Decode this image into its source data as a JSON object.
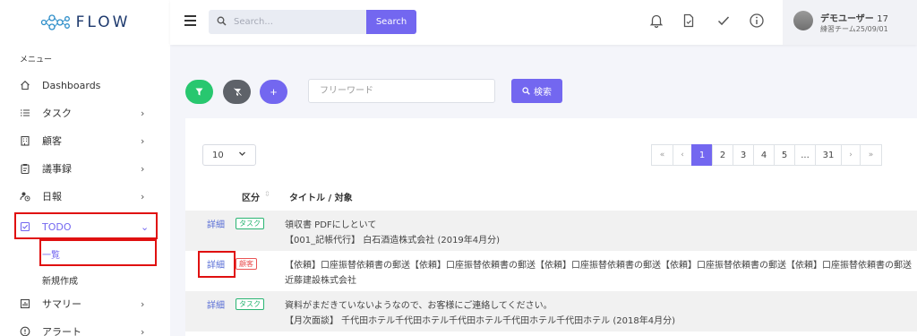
{
  "brand": {
    "logo_text": "FLOW"
  },
  "sidebar": {
    "menu_header": "メニュー",
    "items": [
      {
        "label": "Dashboards",
        "icon": "home-icon"
      },
      {
        "label": "タスク",
        "icon": "list-icon",
        "chevron": "›"
      },
      {
        "label": "顧客",
        "icon": "building-icon",
        "chevron": "›"
      },
      {
        "label": "議事録",
        "icon": "clipboard-icon",
        "chevron": "›"
      },
      {
        "label": "日報",
        "icon": "user-clock-icon",
        "chevron": "›"
      },
      {
        "label": "TODO",
        "icon": "checkbox-icon",
        "chevron": "⌄",
        "expanded": true
      },
      {
        "label": "サマリー",
        "icon": "chart-icon",
        "chevron": "›"
      },
      {
        "label": "アラート",
        "icon": "alert-icon",
        "chevron": "›"
      }
    ],
    "todo_sub": [
      {
        "label": "一覧",
        "active": true
      },
      {
        "label": "新規作成"
      }
    ]
  },
  "topbar": {
    "search_placeholder": "Search...",
    "search_button": "Search",
    "icons": [
      "bell-icon",
      "document-icon",
      "check-icon",
      "info-icon"
    ],
    "user": {
      "name": "デモユーザー",
      "number": "17",
      "team": "練習チーム25/09/01"
    }
  },
  "filters": {
    "buttons": [
      "filter-icon",
      "filter-clear-icon",
      "plus-icon"
    ],
    "keyword_placeholder": "フリーワード",
    "search_label": "検索"
  },
  "table": {
    "per_page": "10",
    "pagination": [
      "«",
      "‹",
      "1",
      "2",
      "3",
      "4",
      "5",
      "...",
      "31",
      "›",
      "»"
    ],
    "current_page": "1",
    "columns": [
      "区分",
      "タイトル / 対象"
    ],
    "rows": [
      {
        "link": "詳細",
        "badge": "タスク",
        "line1": "領収書 PDFにしといて",
        "line2": "【001_記帳代行】 白石酒造株式会社 (2019年4月分)"
      },
      {
        "link": "詳細",
        "badge": "顧客",
        "line1": "【依頼】口座振替依頼書の郵送【依頼】口座振替依頼書の郵送【依頼】口座振替依頼書の郵送【依頼】口座振替依頼書の郵送【依頼】口座振替依頼書の郵送",
        "line2": "近藤建設株式会社"
      },
      {
        "link": "詳細",
        "badge": "タスク",
        "line1": "資料がまだきていないようなので、お客様にご連絡してください。",
        "line2": "【月次面談】 千代田ホテル千代田ホテル千代田ホテル千代田ホテル千代田ホテル (2018年4月分)"
      }
    ]
  },
  "colors": {
    "accent": "#7367f0",
    "green": "#28c76f",
    "gray": "#5e6269",
    "highlight": "#e01010"
  }
}
